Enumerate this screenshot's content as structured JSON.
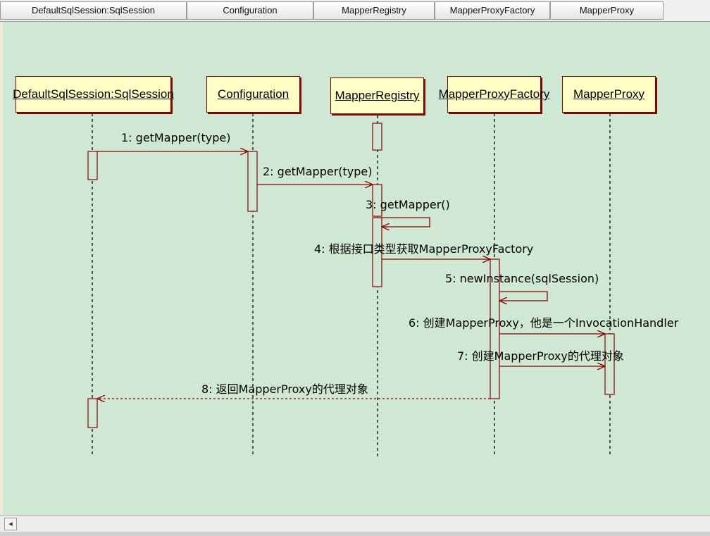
{
  "header": {
    "columns": [
      "DefaultSqlSession:SqlSession",
      "Configuration",
      "MapperRegistry",
      "MapperProxyFactory",
      "MapperProxy"
    ]
  },
  "diagram": {
    "lifelines": [
      "DefaultSqlSession:SqlSession",
      "Configuration",
      "MapperRegistry",
      "MapperProxyFactory",
      "MapperProxy"
    ],
    "messages": [
      "1: getMapper(type)",
      "2: getMapper(type)",
      "3: getMapper()",
      "4: 根据接口类型获取MapperProxyFactory",
      "5: newInstance(sqlSession)",
      "6: 创建MapperProxy，他是一个InvocationHandler",
      "7: 创建MapperProxy的代理对象",
      "8: 返回MapperProxy的代理对象"
    ]
  },
  "colors": {
    "canvas": "#cfe8d3",
    "lifeline_fill": "#ffffc6",
    "line": "#8b0000"
  },
  "scrollbar": {
    "left_arrow": "◂"
  }
}
